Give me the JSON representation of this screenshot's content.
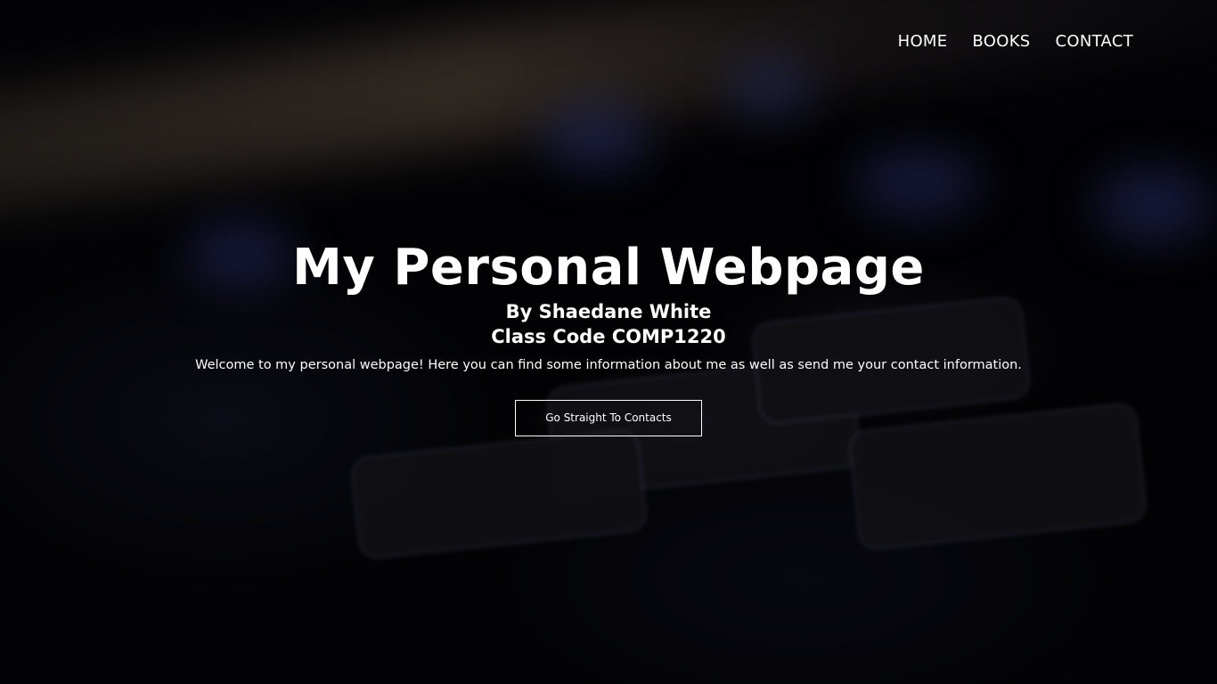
{
  "nav": {
    "items": [
      {
        "label": "HOME"
      },
      {
        "label": "BOOKS"
      },
      {
        "label": "CONTACT"
      }
    ]
  },
  "hero": {
    "title": "My Personal Webpage",
    "author_line": "By Shaedane White",
    "class_line": "Class Code COMP1220",
    "welcome": "Welcome to my personal webpage! Here you can find some information about me as well as send me your contact information.",
    "cta_label": "Go Straight To Contacts"
  }
}
